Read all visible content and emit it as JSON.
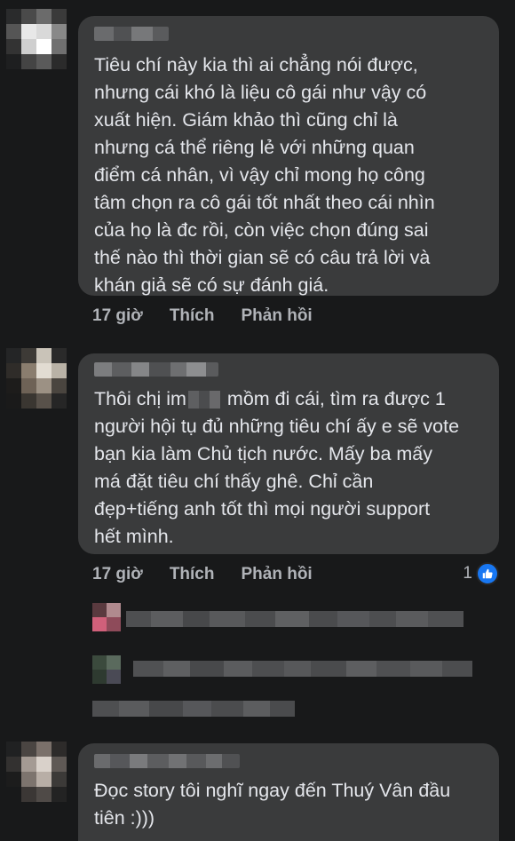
{
  "comments": [
    {
      "text": "Tiêu chí này kia thì ai chẳng nói được,\nnhưng cái khó là liệu cô gái như vậy có\nxuất hiện. Giám khảo thì cũng chỉ là\nnhưng cá thể riêng lẻ với những quan\nđiểm cá nhân, vì vậy chỉ mong họ công\ntâm chọn ra cô gái tốt nhất theo cái nhìn\ncủa họ là đc rồi, còn việc chọn đúng sai\nthế nào thì thời gian sẽ có câu trả lời và\nkhán giả sẽ có sự đánh giá.",
      "time": "17 giờ",
      "like_label": "Thích",
      "reply_label": "Phản hồi"
    },
    {
      "text_before_censor": "Thôi chị im",
      "text_after_censor": " mồm đi cái, tìm ra được 1\nngười hội tụ đủ những tiêu chí ấy e sẽ vote\nbạn kia làm Chủ tịch nước. Mấy ba mấy\nmá đặt tiêu chí thấy ghê. Chỉ cần\nđẹp+tiếng anh tốt thì mọi người support\nhết mình.",
      "time": "17 giờ",
      "like_label": "Thích",
      "reply_label": "Phản hồi",
      "reaction_count": "1",
      "reaction_icon": "thumbs-up-icon",
      "reaction_color": "#1877f2"
    },
    {
      "text": "Đọc story tôi nghĩ ngay đến Thuý Vân đầu\ntiên :)))"
    }
  ],
  "colors": {
    "background": "#18191a",
    "bubble": "#3a3b3c",
    "text": "#e4e6eb",
    "secondary_text": "#b0b3b8"
  }
}
